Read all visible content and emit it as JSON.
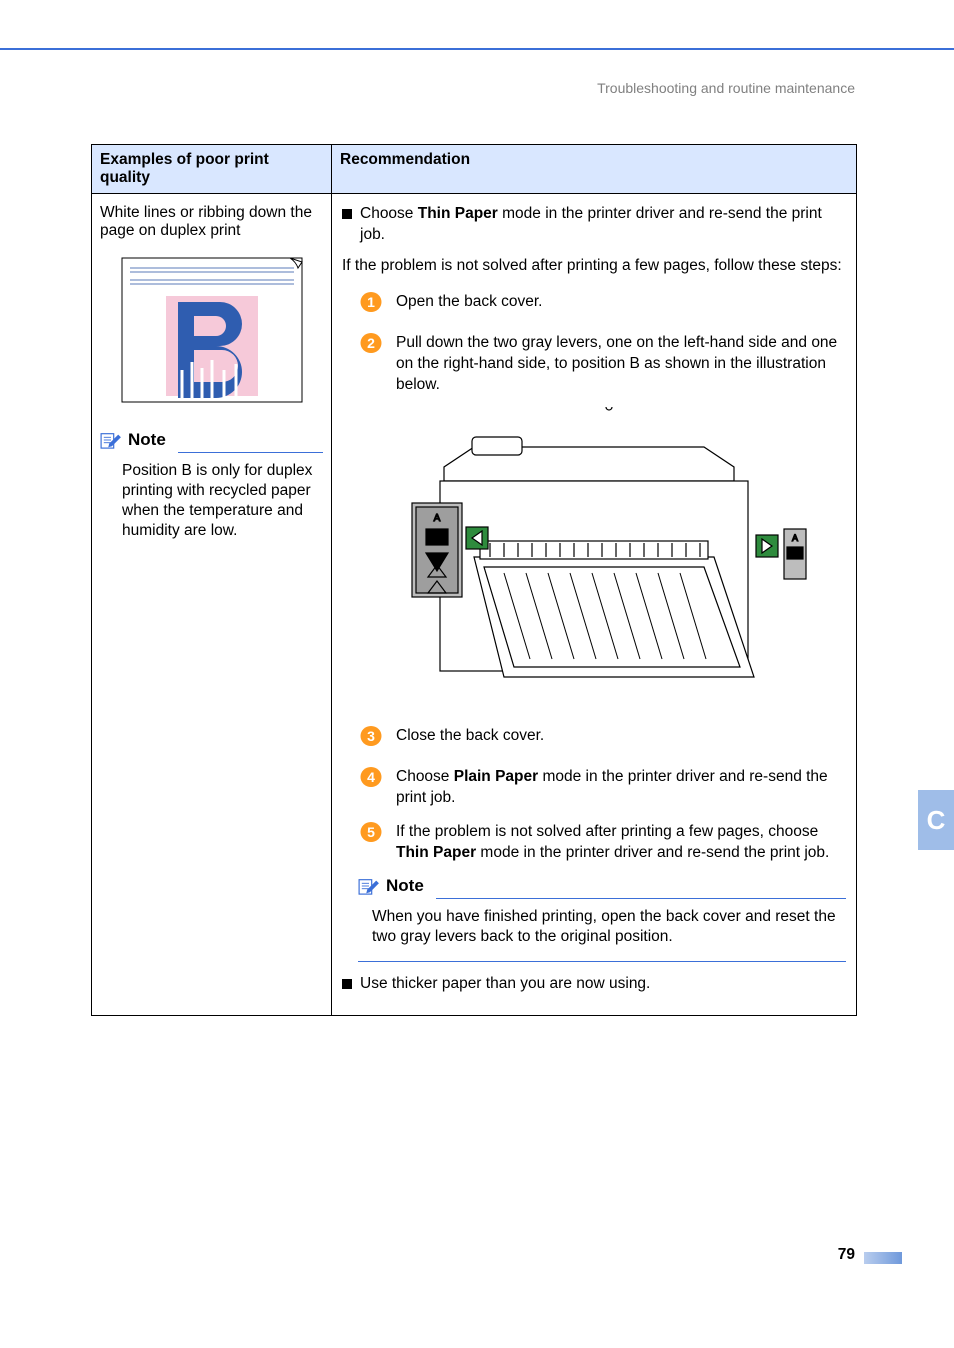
{
  "running_head": "Troubleshooting and routine maintenance",
  "table": {
    "col1_header": "Examples of poor print quality",
    "col2_header": "Recommendation",
    "row": {
      "problem": "White lines or ribbing down the page on duplex print",
      "left_note": {
        "label": "Note",
        "body": "Position B is only for duplex printing with recycled paper when the temperature and humidity are low."
      },
      "rec": {
        "bullet1_pre": "Choose ",
        "bullet1_bold": "Thin Paper",
        "bullet1_post": " mode in the printer driver and re-send the print job.",
        "intro_after": "If the problem is not solved after printing a few pages, follow these steps:",
        "steps": {
          "s1": "Open the back cover.",
          "s2": "Pull down the two gray levers, one on the left-hand side and one on the right-hand side, to position B as shown in the illustration below.",
          "s3": "Close the back cover.",
          "s4_pre": "Choose ",
          "s4_bold": "Plain Paper",
          "s4_post": " mode in the printer driver and re-send the print job.",
          "s5_pre": "If the problem is not solved after printing a few pages, choose ",
          "s5_bold": "Thin Paper",
          "s5_post": " mode in the printer driver and re-send the print job."
        },
        "right_note": {
          "label": "Note",
          "body": "When you have finished printing, open the back cover and reset the two gray levers back to the original position."
        },
        "bullet2": "Use thicker paper than you are now using."
      }
    }
  },
  "side_tab": "C",
  "page_number": "79",
  "step_nums": {
    "n1": "1",
    "n2": "2",
    "n3": "3",
    "n4": "4",
    "n5": "5"
  },
  "colors": {
    "accent": "#3b6fd8",
    "header_bg": "#d9e7ff",
    "tab_bg": "#9fbde8",
    "step_fill": "#ff9a1f"
  }
}
